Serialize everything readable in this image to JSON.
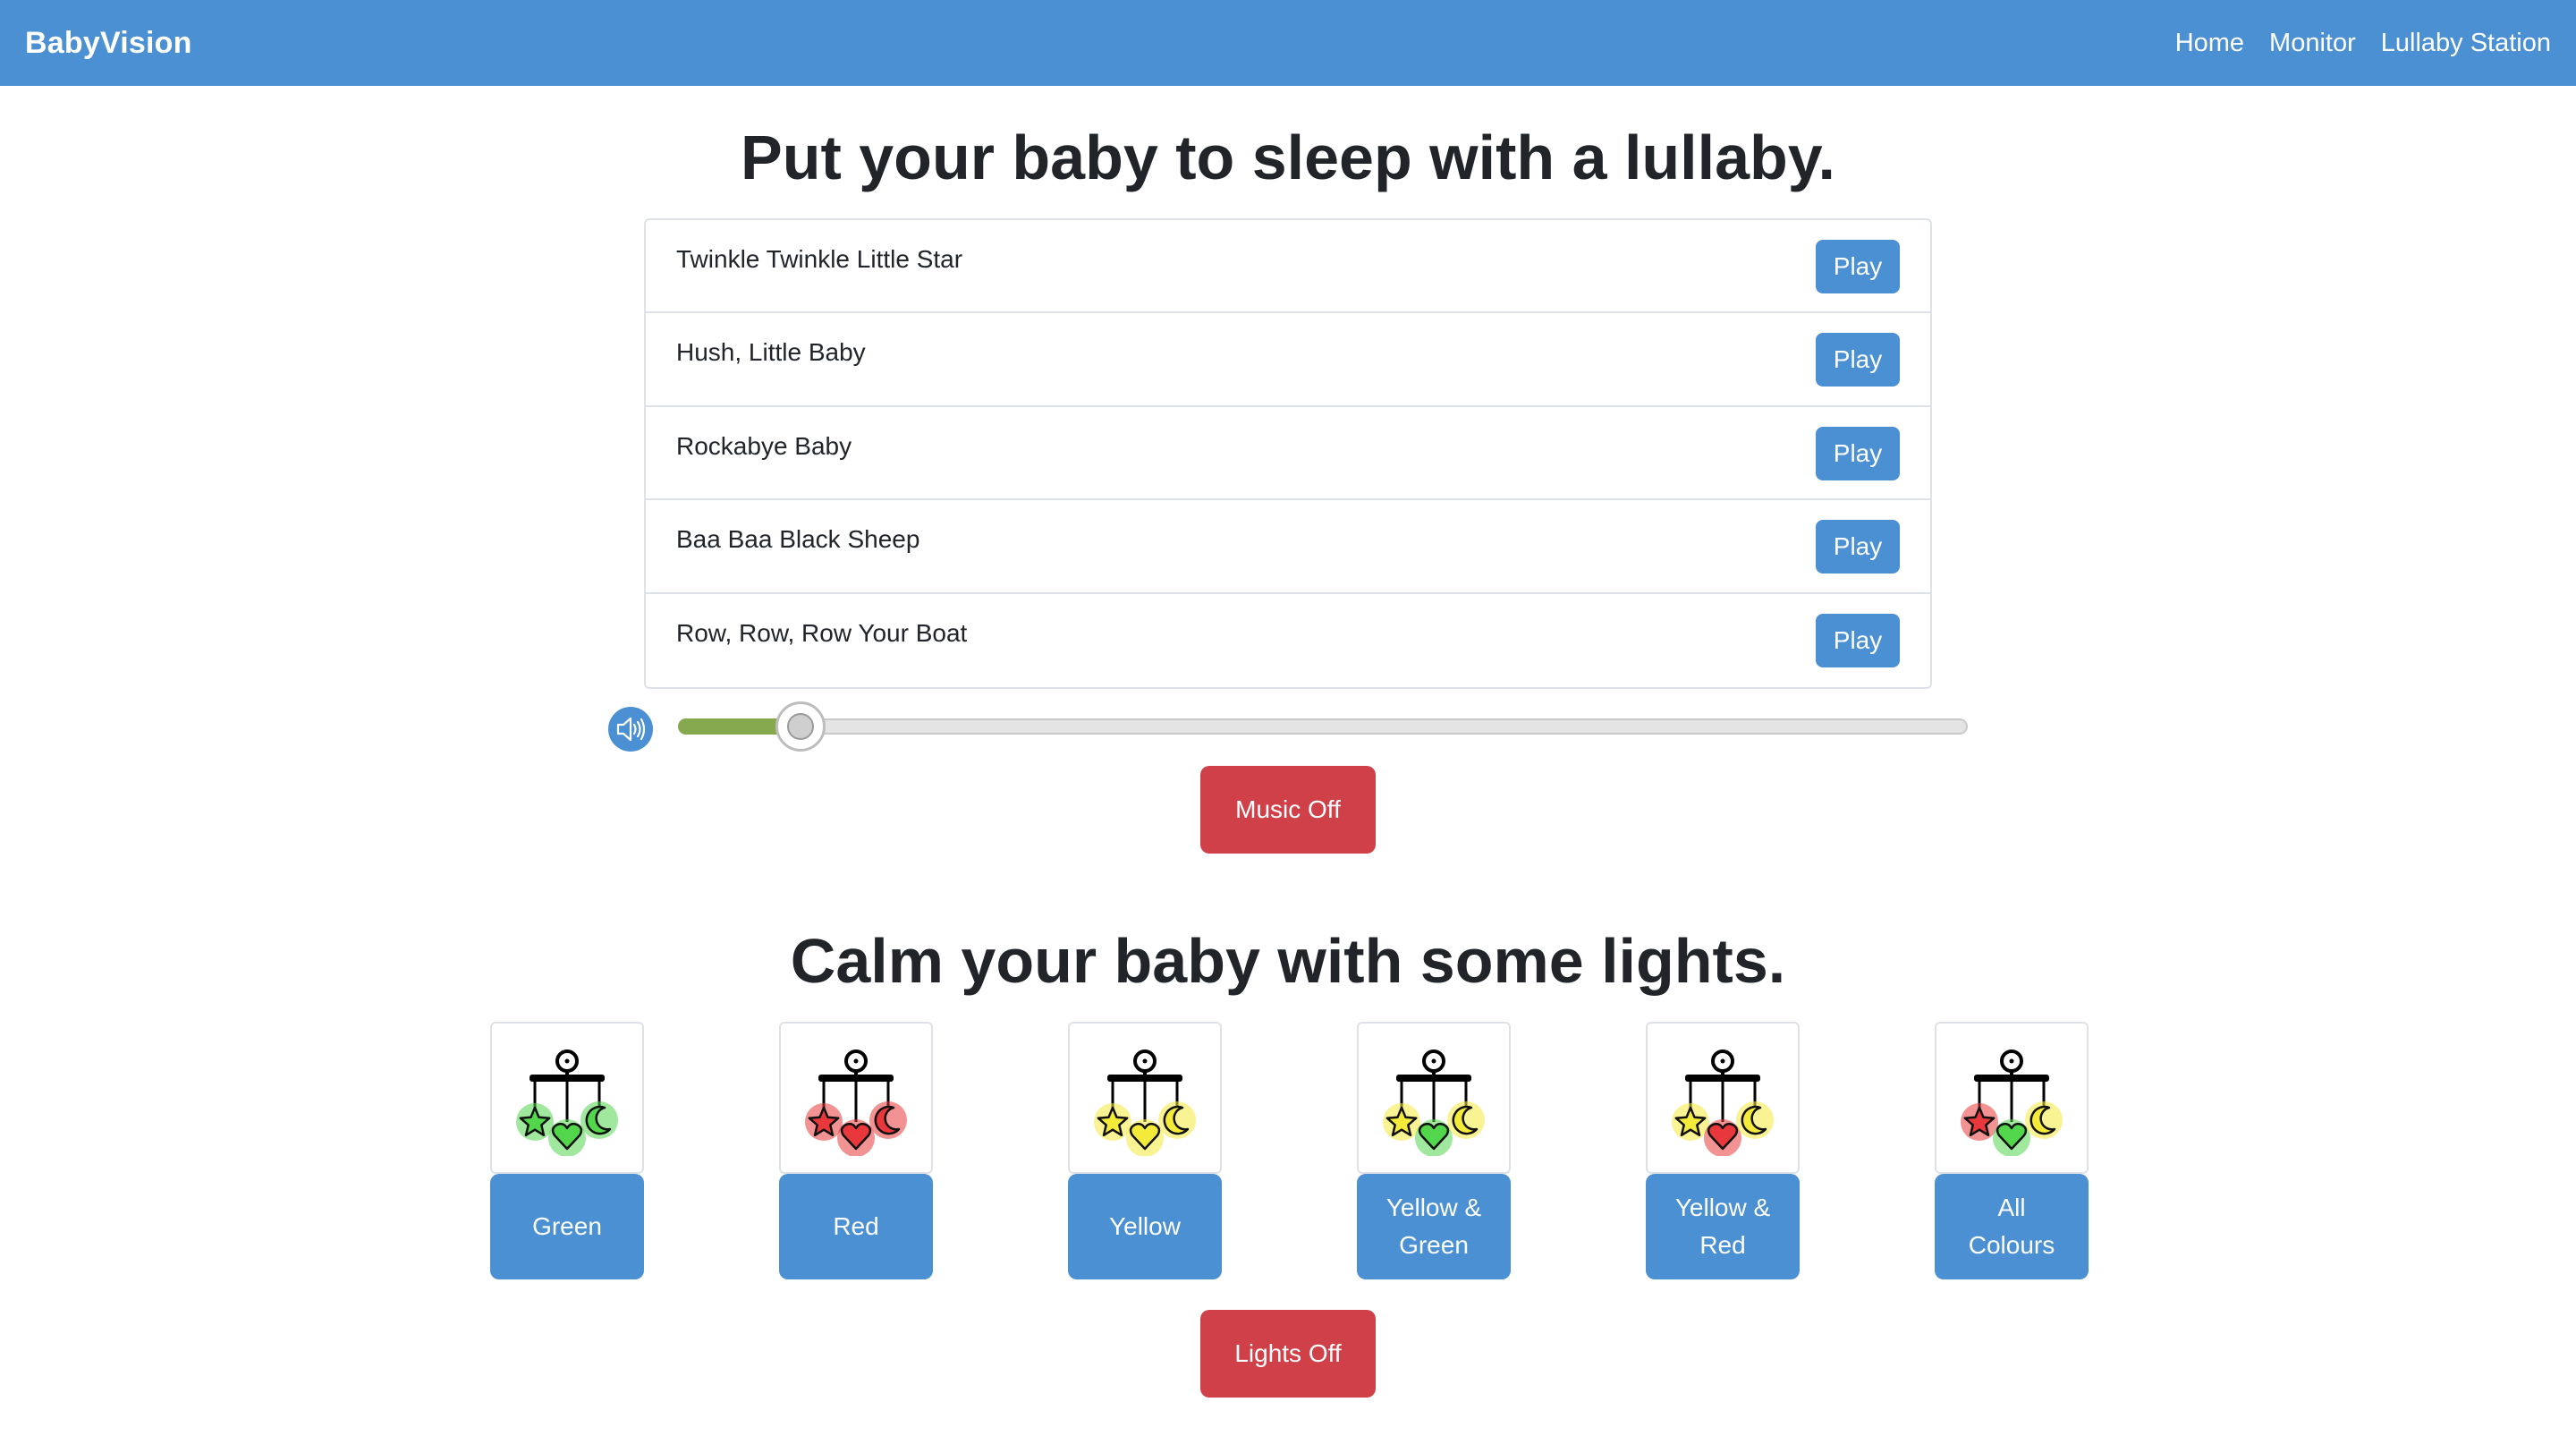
{
  "nav": {
    "brand": "BabyVision",
    "links": [
      "Home",
      "Monitor",
      "Lullaby Station"
    ]
  },
  "lullaby": {
    "title": "Put your baby to sleep with a lullaby.",
    "songs": [
      {
        "title": "Twinkle Twinkle Little Star",
        "button": "Play"
      },
      {
        "title": "Hush, Little Baby",
        "button": "Play"
      },
      {
        "title": "Rockabye Baby",
        "button": "Play"
      },
      {
        "title": "Baa Baa Black Sheep",
        "button": "Play"
      },
      {
        "title": "Row, Row, Row Your Boat",
        "button": "Play"
      }
    ],
    "volume_fraction": 0.095,
    "volume_icon": "speaker-icon",
    "music_off_label": "Music Off"
  },
  "lights": {
    "title": "Calm your baby with some lights.",
    "options": [
      {
        "label": "Green",
        "colors": [
          "#52d64c",
          "#52d64c",
          "#52d64c"
        ]
      },
      {
        "label": "Red",
        "colors": [
          "#e8383b",
          "#e8383b",
          "#e8383b"
        ]
      },
      {
        "label": "Yellow",
        "colors": [
          "#f4ea3a",
          "#f4ea3a",
          "#f4ea3a"
        ]
      },
      {
        "label": "Yellow & Green",
        "colors": [
          "#f4ea3a",
          "#52d64c",
          "#f4ea3a"
        ]
      },
      {
        "label": "Yellow & Red",
        "colors": [
          "#f4ea3a",
          "#e8383b",
          "#f4ea3a"
        ]
      },
      {
        "label": "All Colours",
        "colors": [
          "#e8383b",
          "#52d64c",
          "#f4ea3a"
        ]
      }
    ],
    "image_icon": "baby-mobile-icon",
    "lights_off_label": "Lights Off"
  },
  "colors": {
    "primary": "#4a90d2",
    "danger": "#cf4048",
    "slider_fill": "#86a84f"
  }
}
